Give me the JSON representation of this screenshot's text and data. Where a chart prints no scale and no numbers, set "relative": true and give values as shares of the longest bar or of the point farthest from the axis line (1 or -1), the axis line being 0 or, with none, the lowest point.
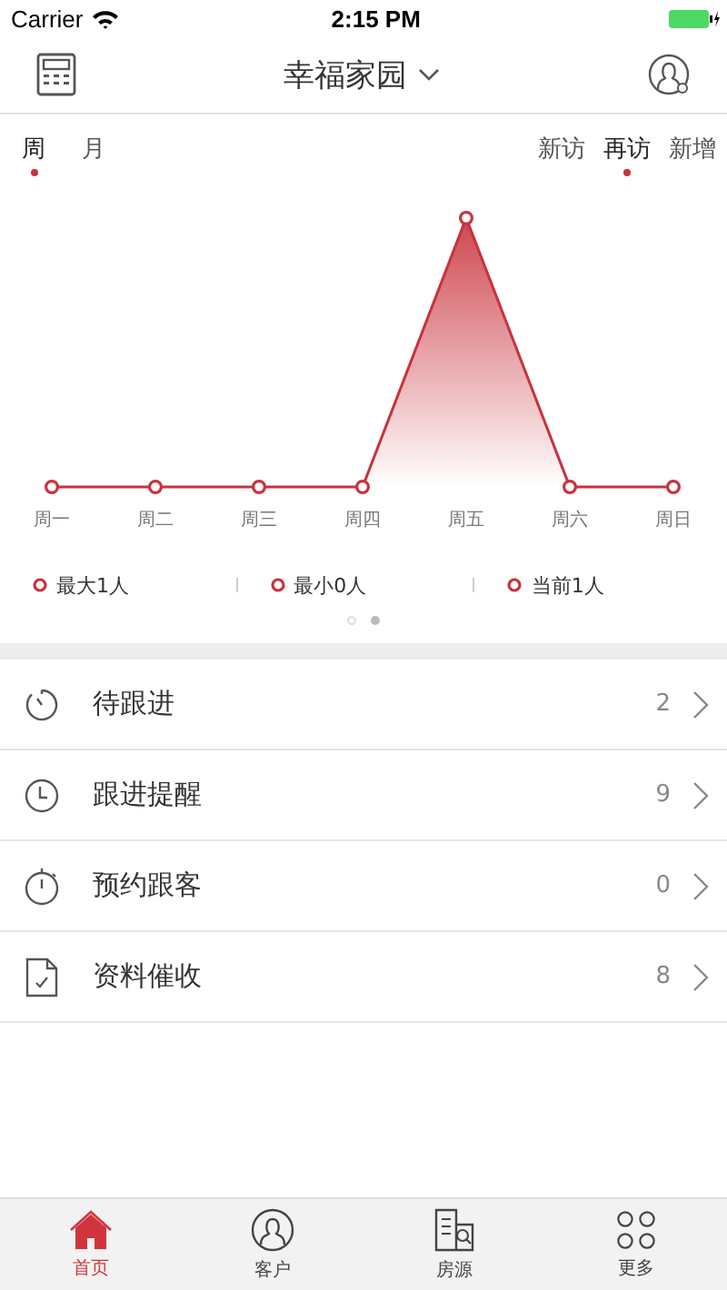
{
  "status_bar": {
    "carrier": "Carrier",
    "time": "2:15 PM"
  },
  "nav": {
    "title": "幸福家园"
  },
  "period_tabs": [
    {
      "label": "周",
      "selected": true
    },
    {
      "label": "月",
      "selected": false
    }
  ],
  "type_tabs": [
    {
      "label": "新访",
      "selected": false
    },
    {
      "label": "再访",
      "selected": true
    },
    {
      "label": "新增",
      "selected": false
    }
  ],
  "chart": {
    "chart_data": {
      "type": "line",
      "categories": [
        "周一",
        "周二",
        "周三",
        "周四",
        "周五",
        "周六",
        "周日"
      ],
      "relative": true,
      "series": [
        {
          "color": "#c8323c",
          "marker": true,
          "values": [
            0,
            0,
            0,
            0,
            1,
            0,
            0
          ]
        }
      ]
    }
  },
  "stats": [
    {
      "label": "最大1人"
    },
    {
      "label": "最小0人"
    },
    {
      "label": "当前1人"
    }
  ],
  "pager": [
    {
      "selected": false
    },
    {
      "selected": true
    }
  ],
  "list": [
    {
      "kind": "timer",
      "label": "待跟进",
      "count": "2"
    },
    {
      "kind": "clock",
      "label": "跟进提醒",
      "count": "9"
    },
    {
      "kind": "stopwatch",
      "label": "预约跟客",
      "count": "0"
    },
    {
      "kind": "document",
      "label": "资料催收",
      "count": "8"
    }
  ],
  "tab_bar": [
    {
      "kind": "home",
      "label": "首页",
      "selected": true
    },
    {
      "kind": "user",
      "label": "客户",
      "selected": false
    },
    {
      "kind": "building",
      "label": "房源",
      "selected": false
    },
    {
      "kind": "more",
      "label": "更多",
      "selected": false
    }
  ]
}
